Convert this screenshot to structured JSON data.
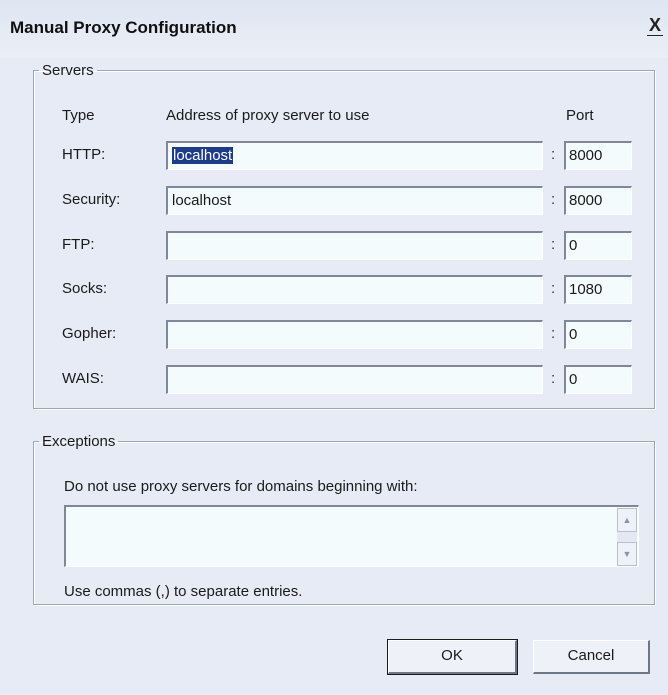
{
  "window": {
    "title": "Manual Proxy Configuration",
    "close_glyph": "X"
  },
  "servers": {
    "legend": "Servers",
    "headers": {
      "type": "Type",
      "address": "Address of proxy server to use",
      "port": "Port"
    },
    "separator": ":",
    "rows": [
      {
        "label": "HTTP:",
        "address": "localhost",
        "port": "8000",
        "address_selected": true
      },
      {
        "label": "Security:",
        "address": "localhost",
        "port": "8000",
        "address_selected": false
      },
      {
        "label": "FTP:",
        "address": "",
        "port": "0",
        "address_selected": false
      },
      {
        "label": "Socks:",
        "address": "",
        "port": "1080",
        "address_selected": false
      },
      {
        "label": "Gopher:",
        "address": "",
        "port": "0",
        "address_selected": false
      },
      {
        "label": "WAIS:",
        "address": "",
        "port": "0",
        "address_selected": false
      }
    ]
  },
  "exceptions": {
    "legend": "Exceptions",
    "label": "Do not use proxy servers for domains beginning with:",
    "value": "",
    "hint": "Use commas (,) to separate entries."
  },
  "buttons": {
    "ok": "OK",
    "cancel": "Cancel"
  },
  "colors": {
    "window_bg": "#e6ebf5",
    "field_bg": "#f4fbfc",
    "selection": "#1d3b8c"
  }
}
